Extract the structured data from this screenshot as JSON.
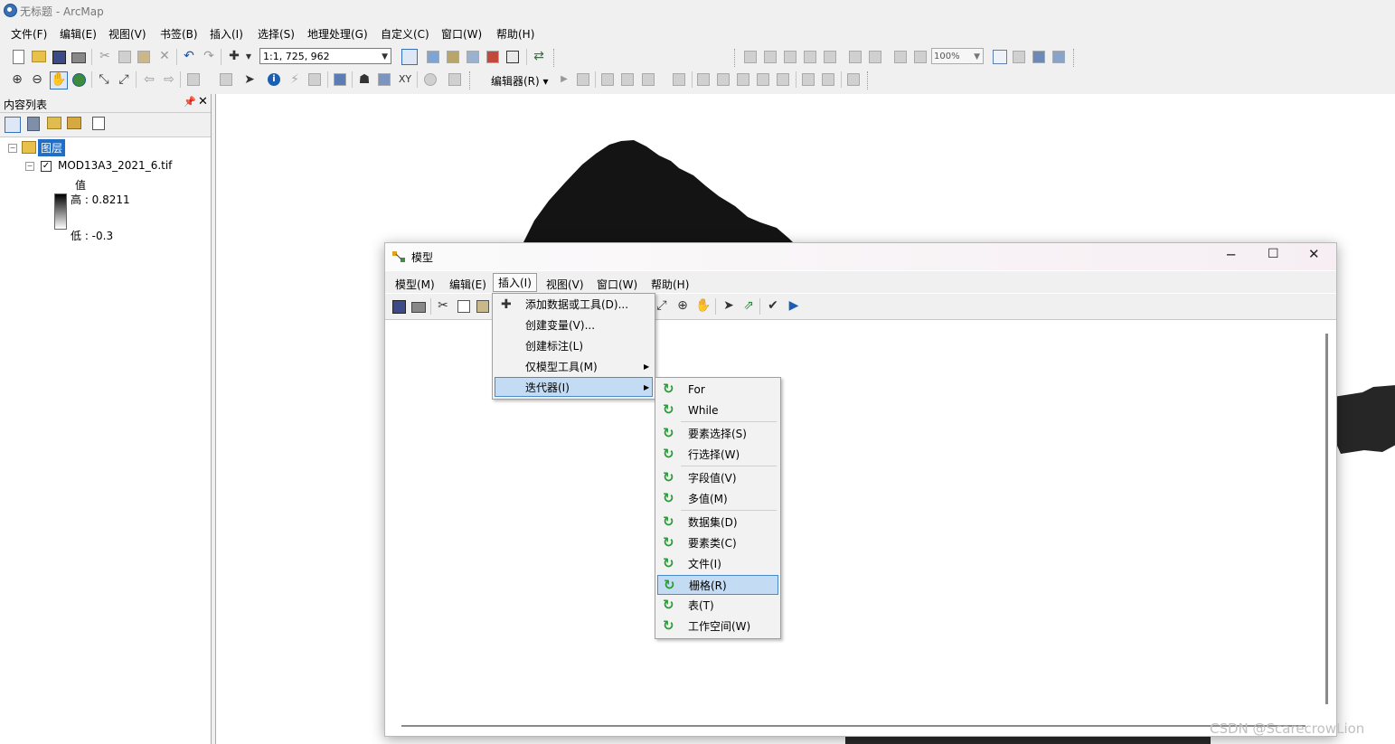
{
  "app": {
    "title": "无标题 - ArcMap"
  },
  "menubar": [
    "文件(F)",
    "编辑(E)",
    "视图(V)",
    "书签(B)",
    "插入(I)",
    "选择(S)",
    "地理处理(G)",
    "自定义(C)",
    "窗口(W)",
    "帮助(H)"
  ],
  "toolbar": {
    "scale": "1:1, 725, 962",
    "zoom": "100%",
    "editor": "编辑器(R)"
  },
  "toc": {
    "title": "内容列表",
    "group": "图层",
    "layer": "MOD13A3_2021_6.tif",
    "value_label": "值",
    "high": "高 : 0.8211",
    "low": "低 : -0.3"
  },
  "model": {
    "title": "模型",
    "menu": [
      "模型(M)",
      "编辑(E)",
      "插入(I)",
      "视图(V)",
      "窗口(W)",
      "帮助(H)"
    ],
    "insert_menu": [
      "添加数据或工具(D)...",
      "创建变量(V)...",
      "创建标注(L)",
      "仅模型工具(M)",
      "迭代器(I)"
    ],
    "iterator_menu": [
      "For",
      "While",
      "要素选择(S)",
      "行选择(W)",
      "字段值(V)",
      "多值(M)",
      "数据集(D)",
      "要素类(C)",
      "文件(I)",
      "栅格(R)",
      "表(T)",
      "工作空间(W)"
    ],
    "selected_iterator": "栅格(R)"
  },
  "watermark": "CSDN @ScarecrowLion",
  "icons": [
    "search-icon",
    "new-document-icon",
    "open-folder-icon",
    "save-icon",
    "print-icon",
    "cut-icon",
    "copy-icon",
    "paste-icon",
    "delete-icon",
    "undo-icon",
    "redo-icon",
    "add-data-icon",
    "zoom-in-icon",
    "zoom-out-icon",
    "pan-icon",
    "globe-icon",
    "identify-icon",
    "pin-icon",
    "close-icon",
    "iterator-icon"
  ]
}
